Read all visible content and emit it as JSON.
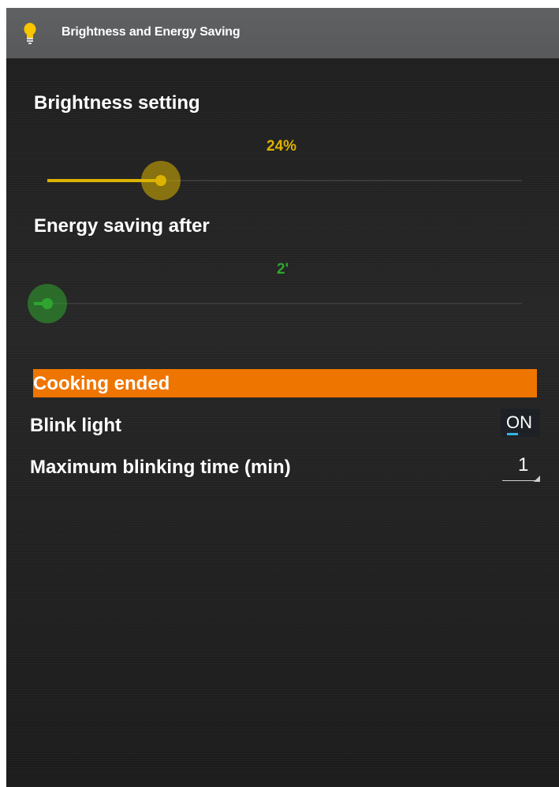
{
  "header": {
    "title": "Brightness and Energy Saving",
    "icon": "lightbulb-icon"
  },
  "brightness": {
    "label": "Brightness setting",
    "value_text": "24%",
    "value": 24,
    "color": "#dcb300"
  },
  "energy_saving": {
    "label": "Energy saving after",
    "value_text": "2'",
    "value": 0,
    "color": "#2fa52f"
  },
  "cooking_ended": {
    "title": "Cooking ended",
    "color": "#ee7500",
    "blink_light": {
      "label": "Blink light",
      "value": "ON"
    },
    "max_blinking_time": {
      "label": "Maximum blinking time (min)",
      "value": "1"
    }
  }
}
